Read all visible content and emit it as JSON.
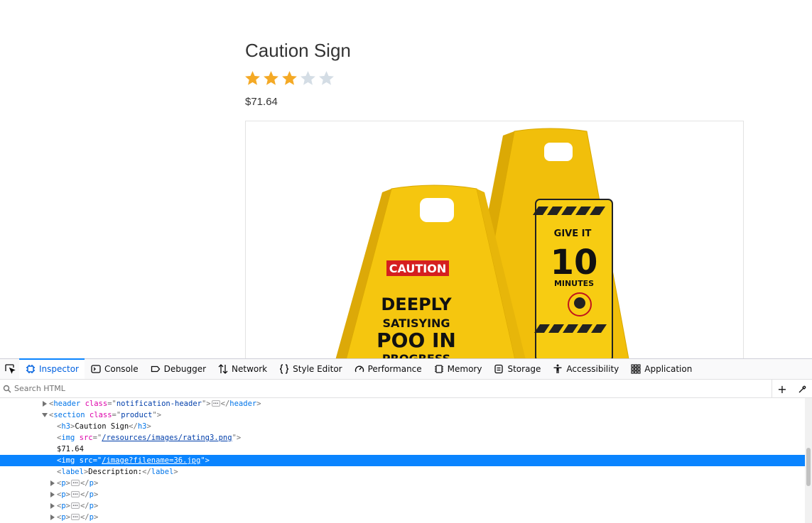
{
  "product": {
    "title": "Caution Sign",
    "rating": 3,
    "rating_max": 5,
    "price": "$71.64",
    "image_text": {
      "front_header": "CAUTION",
      "front_line1": "DEEPLY",
      "front_line2": "SATISYING",
      "front_line3": "POO IN",
      "front_line4": "PROGRESS",
      "back_line1": "GIVE IT",
      "back_line2": "10",
      "back_line3": "MINUTES"
    },
    "colors": {
      "star_filled": "#f4a925",
      "star_empty": "#d4dde5",
      "sign_yellow": "#f5c60f"
    }
  },
  "devtools": {
    "tabs": [
      {
        "label": "Inspector",
        "icon": "inspector-icon"
      },
      {
        "label": "Console",
        "icon": "console-icon"
      },
      {
        "label": "Debugger",
        "icon": "debugger-icon"
      },
      {
        "label": "Network",
        "icon": "network-icon"
      },
      {
        "label": "Style Editor",
        "icon": "style-editor-icon"
      },
      {
        "label": "Performance",
        "icon": "performance-icon"
      },
      {
        "label": "Memory",
        "icon": "memory-icon"
      },
      {
        "label": "Storage",
        "icon": "storage-icon"
      },
      {
        "label": "Accessibility",
        "icon": "accessibility-icon"
      },
      {
        "label": "Application",
        "icon": "application-icon"
      }
    ],
    "selected_tab": "Inspector",
    "search_placeholder": "Search HTML",
    "markup": {
      "header_tag": "header",
      "header_class_attr": "class",
      "header_class_val": "notification-header",
      "section_tag": "section",
      "section_class_attr": "class",
      "section_class_val": "product",
      "h3_tag": "h3",
      "h3_text": "Caution Sign",
      "img1_tag": "img",
      "img1_attr": "src",
      "img1_src": "/resources/images/rating3.png",
      "price_text": "$71.64",
      "img2_tag": "img",
      "img2_attr": "src",
      "img2_src": "/image?filename=36.jpg",
      "label_tag": "label",
      "label_text": "Description:",
      "p_tag": "p"
    }
  }
}
